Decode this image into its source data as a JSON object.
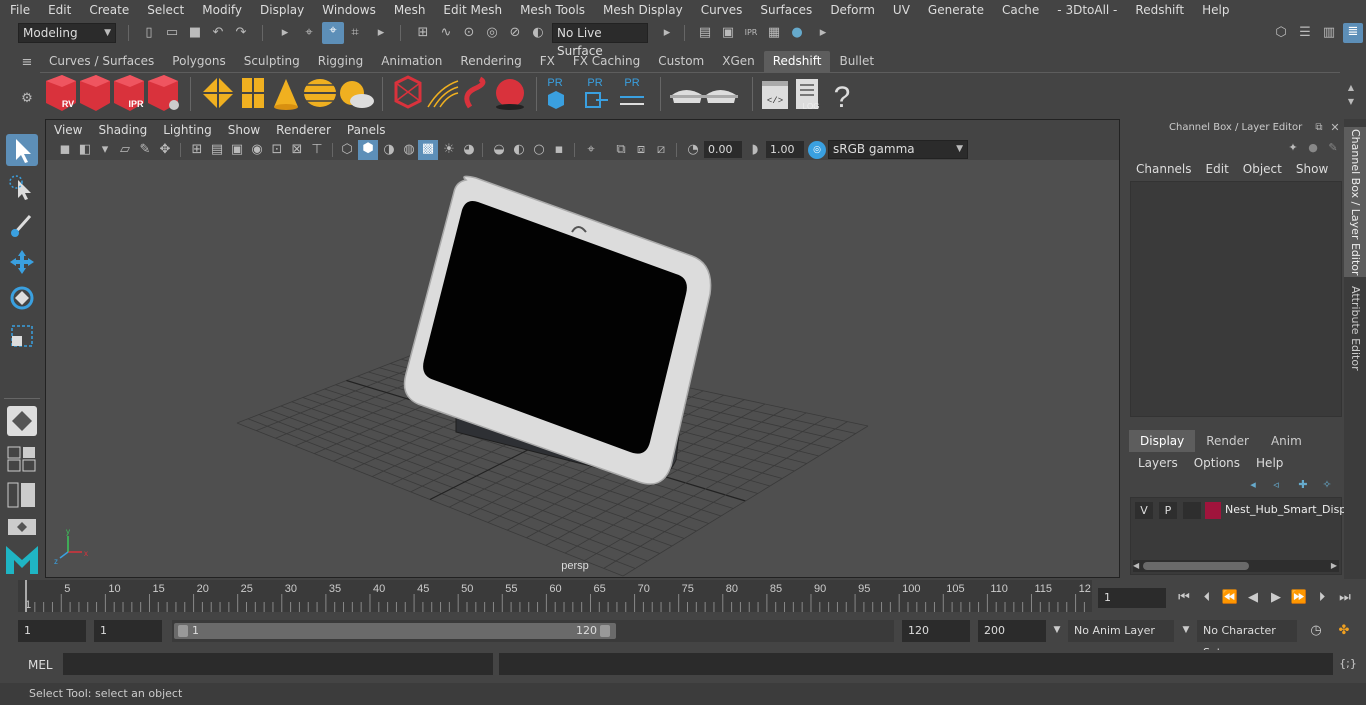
{
  "menubar": [
    "File",
    "Edit",
    "Create",
    "Select",
    "Modify",
    "Display",
    "Windows",
    "Mesh",
    "Edit Mesh",
    "Mesh Tools",
    "Mesh Display",
    "Curves",
    "Surfaces",
    "Deform",
    "UV",
    "Generate",
    "Cache",
    "- 3DtoAll -",
    "Redshift",
    "Help"
  ],
  "statusline": {
    "mode": "Modeling",
    "live_surface": "No Live Surface"
  },
  "shelf_tabs": [
    "Curves / Surfaces",
    "Polygons",
    "Sculpting",
    "Rigging",
    "Animation",
    "Rendering",
    "FX",
    "FX Caching",
    "Custom",
    "XGen",
    "Redshift",
    "Bullet"
  ],
  "shelf_active": "Redshift",
  "shelf_labels": {
    "rv": "RV",
    "ipr": "IPR",
    "pr1": "PR",
    "pr2": "PR",
    "pr3": "PR",
    "log": "LOG",
    "help": "?"
  },
  "viewport": {
    "menu": [
      "View",
      "Shading",
      "Lighting",
      "Show",
      "Renderer",
      "Panels"
    ],
    "exposure": "0.00",
    "gamma": "1.00",
    "color_space": "sRGB gamma",
    "camera_label": "persp"
  },
  "channel_box": {
    "title": "Channel Box / Layer Editor",
    "menu": [
      "Channels",
      "Edit",
      "Object",
      "Show"
    ]
  },
  "layer_editor": {
    "tabs": [
      "Display",
      "Render",
      "Anim"
    ],
    "active_tab": "Display",
    "menu": [
      "Layers",
      "Options",
      "Help"
    ],
    "layer": {
      "v": "V",
      "p": "P",
      "name": "Nest_Hub_Smart_Displ",
      "color": "#a0143c"
    }
  },
  "side_tabs": [
    "Channel Box / Layer Editor",
    "Attribute Editor"
  ],
  "timeline": {
    "ticks": [
      "1",
      "5",
      "10",
      "15",
      "20",
      "25",
      "30",
      "35",
      "40",
      "45",
      "50",
      "55",
      "60",
      "65",
      "70",
      "75",
      "80",
      "85",
      "90",
      "95",
      "100",
      "105",
      "110",
      "115",
      "12"
    ],
    "current_frame": "1"
  },
  "range": {
    "start": "1",
    "playback_start": "1",
    "slider_start": "1",
    "slider_end": "120",
    "playback_end": "120",
    "end": "200",
    "anim_layer": "No Anim Layer",
    "character_set": "No Character Set"
  },
  "cmdline": {
    "lang": "MEL"
  },
  "help_line": "Select Tool: select an object",
  "colors": {
    "accent": "#5d8fb8",
    "shelf_red": "#d9323c",
    "shelf_yellow": "#f0b020",
    "pr_blue": "#3aa0e0"
  }
}
